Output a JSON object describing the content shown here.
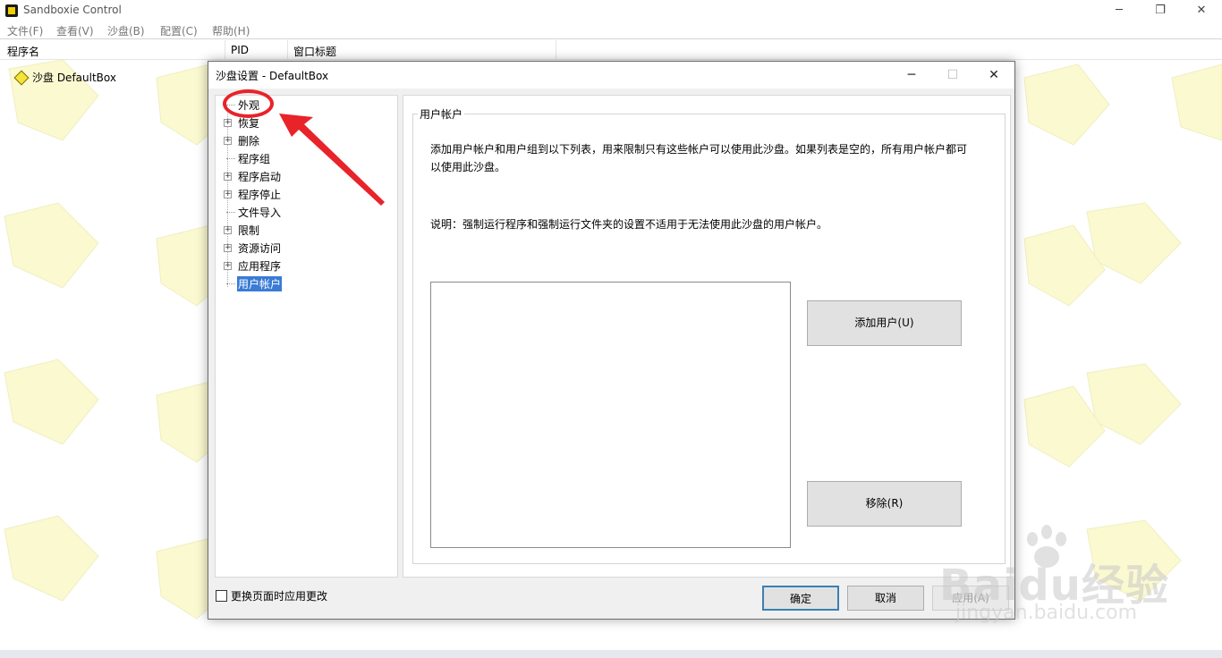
{
  "main_window": {
    "title": "Sandboxie Control",
    "menu": [
      "文件(F)",
      "查看(V)",
      "沙盘(B)",
      "配置(C)",
      "帮助(H)"
    ],
    "columns": [
      "程序名",
      "PID",
      "窗口标题"
    ],
    "sandbox_label": "沙盘 DefaultBox"
  },
  "dialog": {
    "title": "沙盘设置 - DefaultBox",
    "tree": [
      {
        "label": "外观",
        "expandable": false
      },
      {
        "label": "恢复",
        "expandable": true
      },
      {
        "label": "删除",
        "expandable": true
      },
      {
        "label": "程序组",
        "expandable": false
      },
      {
        "label": "程序启动",
        "expandable": true
      },
      {
        "label": "程序停止",
        "expandable": true
      },
      {
        "label": "文件导入",
        "expandable": false
      },
      {
        "label": "限制",
        "expandable": true
      },
      {
        "label": "资源访问",
        "expandable": true
      },
      {
        "label": "应用程序",
        "expandable": true
      },
      {
        "label": "用户帐户",
        "expandable": false,
        "selected": true
      }
    ],
    "group_title": "用户帐户",
    "description": "添加用户帐户和用户组到以下列表，用来限制只有这些帐户可以使用此沙盘。如果列表是空的，所有用户帐户都可以使用此沙盘。",
    "note": "说明：强制运行程序和强制运行文件夹的设置不适用于无法使用此沙盘的用户帐户。",
    "add_button": "添加用户(U)",
    "remove_button": "移除(R)",
    "checkbox_label": "更换页面时应用更改",
    "ok_button": "确定",
    "cancel_button": "取消",
    "apply_button": "应用(A)"
  },
  "watermark": {
    "brand": "Baidu经验",
    "url": "jingyan.baidu.com"
  },
  "colors": {
    "annotation": "#e8232a",
    "selection": "#3a7bd5",
    "sandbox_tile": "#fbf9d0"
  }
}
